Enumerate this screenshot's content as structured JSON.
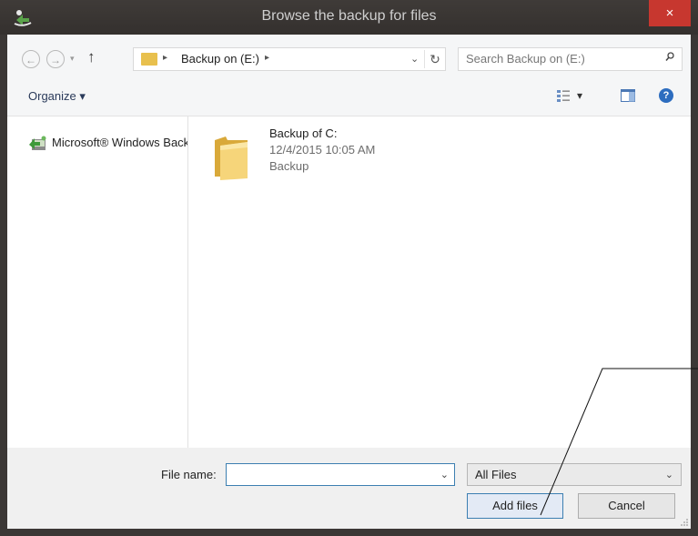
{
  "window": {
    "title": "Browse the backup for files",
    "close_glyph": "×",
    "colors": {
      "titlebar": "#3b3735",
      "close": "#c7372f",
      "accent": "#3c7fb1"
    }
  },
  "nav": {
    "back_glyph": "←",
    "forward_glyph": "→",
    "history_glyph": "▾",
    "up_glyph": "↑",
    "breadcrumb": "Backup on (E:)",
    "crumb_sep": "▸",
    "address_dropdown": "⌄",
    "refresh_glyph": "↻",
    "search_placeholder": "Search Backup on (E:)"
  },
  "toolbar": {
    "organize_label": "Organize ▾",
    "view_dropdown": "▾",
    "help_glyph": "?"
  },
  "navpane": {
    "items": [
      {
        "label": "Microsoft® Windows Backup",
        "icon": "windows-backup-icon"
      }
    ]
  },
  "files": [
    {
      "name": "Backup of C:",
      "date": "12/4/2015 10:05 AM",
      "type": "Backup",
      "icon": "folder-icon"
    }
  ],
  "bottom": {
    "file_name_label": "File name:",
    "file_name_value": "",
    "file_name_dropdown": "⌄",
    "filter_value": "All Files",
    "filter_dropdown": "⌄",
    "add_button": "Add files",
    "cancel_button": "Cancel"
  }
}
